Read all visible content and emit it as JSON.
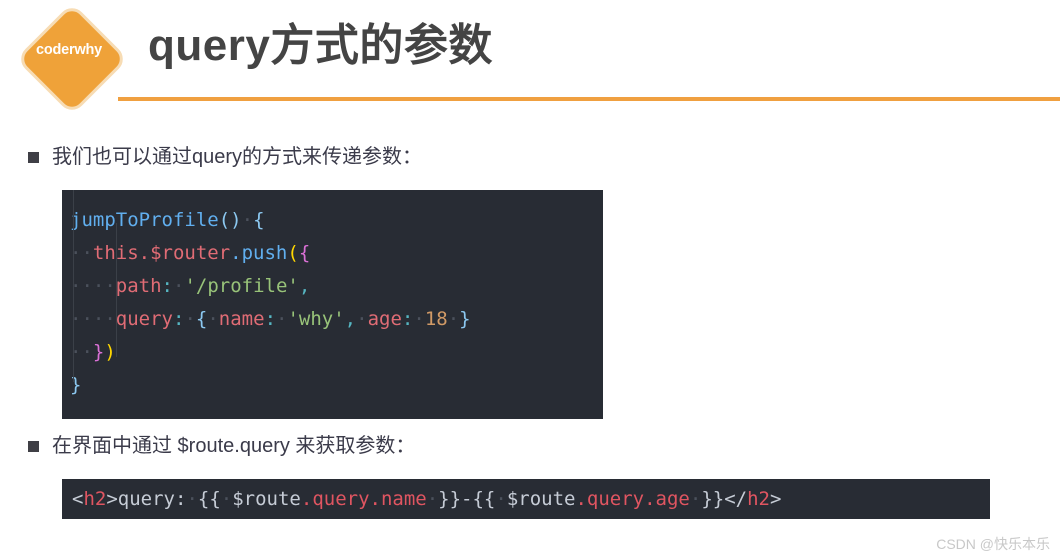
{
  "header": {
    "logo_label": "coderwhy",
    "logo_color": "#efa239",
    "logo_border_color": "#f7dcb4",
    "title": "query方式的参数",
    "rule_color": "#f0a040"
  },
  "bullets": [
    {
      "marker": "square-bullet",
      "text": "我们也可以通过query的方式来传递参数："
    },
    {
      "marker": "square-bullet",
      "text": "在界面中通过 $route.query 来获取参数："
    }
  ],
  "code_block": {
    "background": "#282c34",
    "lines": [
      {
        "tokens": [
          {
            "t": "jumpToProfile",
            "c": "function"
          },
          {
            "t": "()",
            "c": "paren-blue"
          },
          {
            "t": " ",
            "c": "space-dot"
          },
          {
            "t": "{",
            "c": "paren-blue"
          }
        ]
      },
      {
        "tokens": [
          {
            "t": "  ",
            "c": "space-dot"
          },
          {
            "t": "this.$router",
            "c": "variable"
          },
          {
            "t": ".push",
            "c": "function"
          },
          {
            "t": "(",
            "c": "paren-yellow"
          },
          {
            "t": "{",
            "c": "paren-magenta"
          }
        ]
      },
      {
        "tokens": [
          {
            "t": "    ",
            "c": "space-dot"
          },
          {
            "t": "path",
            "c": "key"
          },
          {
            "t": ":",
            "c": "punct"
          },
          {
            "t": " ",
            "c": "space-dot"
          },
          {
            "t": "'/profile'",
            "c": "string"
          },
          {
            "t": ",",
            "c": "punct"
          }
        ]
      },
      {
        "tokens": [
          {
            "t": "    ",
            "c": "space-dot"
          },
          {
            "t": "query",
            "c": "key"
          },
          {
            "t": ":",
            "c": "punct"
          },
          {
            "t": " ",
            "c": "space-dot"
          },
          {
            "t": "{",
            "c": "paren-blue"
          },
          {
            "t": " ",
            "c": "space-dot"
          },
          {
            "t": "name",
            "c": "key"
          },
          {
            "t": ":",
            "c": "punct"
          },
          {
            "t": " ",
            "c": "space-dot"
          },
          {
            "t": "'why'",
            "c": "string"
          },
          {
            "t": ",",
            "c": "punct"
          },
          {
            "t": " ",
            "c": "space-dot"
          },
          {
            "t": "age",
            "c": "key"
          },
          {
            "t": ":",
            "c": "punct"
          },
          {
            "t": " ",
            "c": "space-dot"
          },
          {
            "t": "18",
            "c": "number"
          },
          {
            "t": " ",
            "c": "space-dot"
          },
          {
            "t": "}",
            "c": "paren-blue"
          }
        ]
      },
      {
        "tokens": [
          {
            "t": "  ",
            "c": "space-dot"
          },
          {
            "t": "}",
            "c": "paren-magenta"
          },
          {
            "t": ")",
            "c": "paren-yellow"
          }
        ]
      },
      {
        "tokens": [
          {
            "t": "}",
            "c": "paren-blue"
          }
        ]
      }
    ],
    "plain_text": "jumpToProfile() {\n  this.$router.push({\n    path: '/profile',\n    query: { name: 'why', age: 18 }\n  })\n}"
  },
  "code_bar": {
    "background": "#282c34",
    "tokens": [
      {
        "t": "<",
        "c": "tag-punct"
      },
      {
        "t": "h2",
        "c": "tag-name"
      },
      {
        "t": ">",
        "c": "tag-punct"
      },
      {
        "t": "query:",
        "c": "plain"
      },
      {
        "t": " ",
        "c": "space-dot"
      },
      {
        "t": "{{",
        "c": "plain"
      },
      {
        "t": " ",
        "c": "space-dot"
      },
      {
        "t": "$route",
        "c": "plain"
      },
      {
        "t": ".query.name",
        "c": "prop"
      },
      {
        "t": " ",
        "c": "space-dot"
      },
      {
        "t": "}}-{{",
        "c": "plain"
      },
      {
        "t": " ",
        "c": "space-dot"
      },
      {
        "t": "$route",
        "c": "plain"
      },
      {
        "t": ".query.age",
        "c": "prop"
      },
      {
        "t": " ",
        "c": "space-dot"
      },
      {
        "t": "}}",
        "c": "plain"
      },
      {
        "t": "</",
        "c": "tag-punct"
      },
      {
        "t": "h2",
        "c": "tag-name"
      },
      {
        "t": ">",
        "c": "tag-punct"
      }
    ],
    "plain_text": "<h2>query: {{ $route.query.name }}-{{ $route.query.age }}</h2>"
  },
  "watermark": "CSDN @快乐本乐"
}
